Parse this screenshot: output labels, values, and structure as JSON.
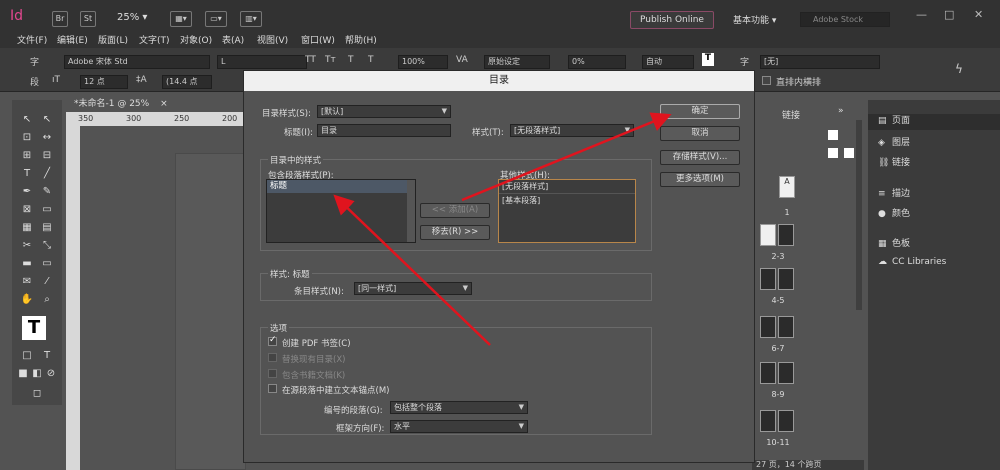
{
  "app": {
    "logo": "Id",
    "bridge": "Br",
    "stock_btn": "St",
    "zoom": "25% ▾",
    "publish": "Publish Online",
    "workspace": "基本功能 ▾",
    "search_placeholder": "Adobe Stock",
    "win_controls": [
      "—",
      "□",
      "✕"
    ]
  },
  "menu": [
    "文件(F)",
    "编辑(E)",
    "版面(L)",
    "文字(T)",
    "对象(O)",
    "表(A)",
    "视图(V)",
    "窗口(W)",
    "帮助(H)"
  ],
  "control": {
    "font_family": "Adobe 宋体 Std",
    "font_style": "L",
    "font_size": "12 点",
    "leading": "(14.4 点",
    "scale": "100%",
    "kerning": "原始设定",
    "tracking": "0%",
    "auto": "自动",
    "char_style": "[无]",
    "vertical": "直排内横排",
    "char_label": "字",
    "para_label": "段",
    "tt_buttons": [
      "TT",
      "Tт",
      "T",
      "T"
    ]
  },
  "document": {
    "tab": "*未命名-1 @ 25%",
    "tab_close": "×",
    "ruler": [
      "350",
      "300",
      "250",
      "200"
    ]
  },
  "panels": {
    "tabs": [
      "链接"
    ],
    "items": [
      {
        "icon": "▤",
        "label": "页面"
      },
      {
        "icon": "◈",
        "label": "图层"
      },
      {
        "icon": "⛓",
        "label": "链接"
      },
      {
        "icon": "≡",
        "label": "描边"
      },
      {
        "icon": "●",
        "label": "颜色"
      },
      {
        "icon": "▦",
        "label": "色板"
      },
      {
        "icon": "☁",
        "label": "CC Libraries"
      }
    ],
    "pages": [
      "1",
      "2-3",
      "4-5",
      "6-7",
      "8-9",
      "10-11"
    ],
    "status": "27 页，14 个跨页",
    "parent_a": "A"
  },
  "dialog": {
    "title": "目录",
    "toc_style_label": "目录样式(S):",
    "toc_style_value": "[默认]",
    "title_label": "标题(I):",
    "title_value": "目录",
    "style_label": "样式(T):",
    "style_value": "[无段落样式]",
    "section_styles": "目录中的样式",
    "include_label": "包含段落样式(P):",
    "include_items": [
      "标题"
    ],
    "other_label": "其他样式(H):",
    "other_items": [
      "[无段落样式]",
      "[基本段落]"
    ],
    "add_button": "<< 添加(A)",
    "remove_button": "移去(R) >>",
    "style_heading": "样式: 标题",
    "entry_style_label": "条目样式(N):",
    "entry_style_value": "[同一样式]",
    "options_heading": "选项",
    "opt_pdf": "创建 PDF 书签(C)",
    "opt_replace": "替换现有目录(X)",
    "opt_book": "包含书籍文档(K)",
    "opt_anchor": "在源段落中建立文本锚点(M)",
    "numbered_label": "编号的段落(G):",
    "numbered_value": "包括整个段落",
    "frame_dir_label": "框架方向(F):",
    "frame_dir_value": "水平",
    "ok": "确定",
    "cancel": "取消",
    "save_style": "存储样式(V)...",
    "more_options": "更多选项(M)"
  },
  "annotation_color": "#e0141e"
}
